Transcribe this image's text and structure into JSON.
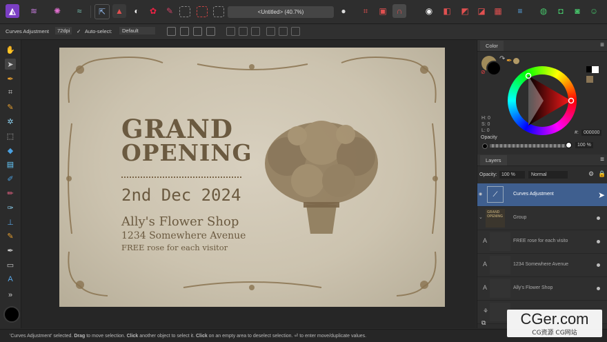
{
  "top_bar": {
    "document_title": "<Untitled> (40.7%)"
  },
  "context_bar": {
    "tool_name": "Curves Adjustment",
    "dpi": "72dpi",
    "auto_select_label": "Auto-select:",
    "auto_select_value": "Default"
  },
  "poster": {
    "title_line1": "GRAND",
    "title_line2": "OPENING",
    "date": "2nd Dec 2024",
    "shop_name": "Ally's Flower Shop",
    "address": "1234 Somewhere Avenue",
    "offer": "FREE rose for each visitor"
  },
  "color_panel": {
    "tab_label": "Color",
    "hsl_h": "H: 0",
    "hsl_s": "S: 0",
    "hsl_l": "L: 0",
    "hex_label": "#:",
    "hex_value": "000000",
    "opacity_label": "Opacity",
    "opacity_value": "100 %"
  },
  "layers_panel": {
    "tab_label": "Layers",
    "opacity_label": "Opacity:",
    "opacity_value": "100 %",
    "blend_mode": "Normal",
    "layers": [
      {
        "name": "Curves Adjustment",
        "type": "adjustment",
        "selected": true
      },
      {
        "name": "Group",
        "type": "group",
        "selected": false
      },
      {
        "name": "FREE rose for each visito",
        "type": "text",
        "selected": false
      },
      {
        "name": "1234 Somewhere Avenue",
        "type": "text",
        "selected": false
      },
      {
        "name": "Ally's Flower Shop",
        "type": "text",
        "selected": false
      }
    ]
  },
  "status_bar": {
    "p1": "'Curves Adjustment' selected. ",
    "b1": "Drag",
    "p2": " to move selection. ",
    "b2": "Click",
    "p3": " another object to select it. ",
    "b3": "Click",
    "p4": " on an empty area to deselect selection. ",
    "p5": " to enter move/duplicate values."
  },
  "watermark": {
    "main": "CGer.com",
    "sub": "CG资源 CG网站"
  },
  "colors": {
    "accent_blue": "#3f5f8f",
    "poster_ink": "#6b5a40",
    "poster_paper": "#cdc5b3"
  }
}
